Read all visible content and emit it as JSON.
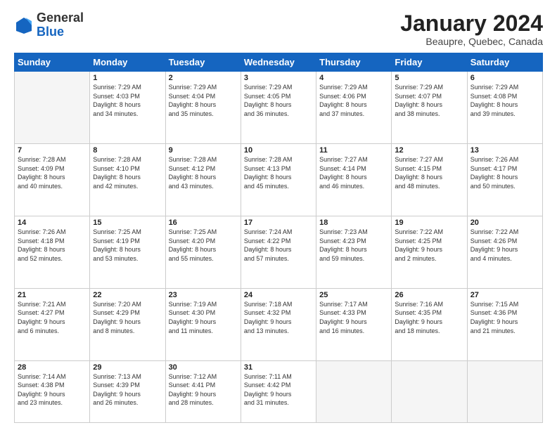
{
  "header": {
    "logo_line1": "General",
    "logo_line2": "Blue",
    "month_title": "January 2024",
    "subtitle": "Beaupre, Quebec, Canada"
  },
  "days_of_week": [
    "Sunday",
    "Monday",
    "Tuesday",
    "Wednesday",
    "Thursday",
    "Friday",
    "Saturday"
  ],
  "weeks": [
    [
      {
        "day": "",
        "info": ""
      },
      {
        "day": "1",
        "info": "Sunrise: 7:29 AM\nSunset: 4:03 PM\nDaylight: 8 hours\nand 34 minutes."
      },
      {
        "day": "2",
        "info": "Sunrise: 7:29 AM\nSunset: 4:04 PM\nDaylight: 8 hours\nand 35 minutes."
      },
      {
        "day": "3",
        "info": "Sunrise: 7:29 AM\nSunset: 4:05 PM\nDaylight: 8 hours\nand 36 minutes."
      },
      {
        "day": "4",
        "info": "Sunrise: 7:29 AM\nSunset: 4:06 PM\nDaylight: 8 hours\nand 37 minutes."
      },
      {
        "day": "5",
        "info": "Sunrise: 7:29 AM\nSunset: 4:07 PM\nDaylight: 8 hours\nand 38 minutes."
      },
      {
        "day": "6",
        "info": "Sunrise: 7:29 AM\nSunset: 4:08 PM\nDaylight: 8 hours\nand 39 minutes."
      }
    ],
    [
      {
        "day": "7",
        "info": "Sunrise: 7:28 AM\nSunset: 4:09 PM\nDaylight: 8 hours\nand 40 minutes."
      },
      {
        "day": "8",
        "info": "Sunrise: 7:28 AM\nSunset: 4:10 PM\nDaylight: 8 hours\nand 42 minutes."
      },
      {
        "day": "9",
        "info": "Sunrise: 7:28 AM\nSunset: 4:12 PM\nDaylight: 8 hours\nand 43 minutes."
      },
      {
        "day": "10",
        "info": "Sunrise: 7:28 AM\nSunset: 4:13 PM\nDaylight: 8 hours\nand 45 minutes."
      },
      {
        "day": "11",
        "info": "Sunrise: 7:27 AM\nSunset: 4:14 PM\nDaylight: 8 hours\nand 46 minutes."
      },
      {
        "day": "12",
        "info": "Sunrise: 7:27 AM\nSunset: 4:15 PM\nDaylight: 8 hours\nand 48 minutes."
      },
      {
        "day": "13",
        "info": "Sunrise: 7:26 AM\nSunset: 4:17 PM\nDaylight: 8 hours\nand 50 minutes."
      }
    ],
    [
      {
        "day": "14",
        "info": "Sunrise: 7:26 AM\nSunset: 4:18 PM\nDaylight: 8 hours\nand 52 minutes."
      },
      {
        "day": "15",
        "info": "Sunrise: 7:25 AM\nSunset: 4:19 PM\nDaylight: 8 hours\nand 53 minutes."
      },
      {
        "day": "16",
        "info": "Sunrise: 7:25 AM\nSunset: 4:20 PM\nDaylight: 8 hours\nand 55 minutes."
      },
      {
        "day": "17",
        "info": "Sunrise: 7:24 AM\nSunset: 4:22 PM\nDaylight: 8 hours\nand 57 minutes."
      },
      {
        "day": "18",
        "info": "Sunrise: 7:23 AM\nSunset: 4:23 PM\nDaylight: 8 hours\nand 59 minutes."
      },
      {
        "day": "19",
        "info": "Sunrise: 7:22 AM\nSunset: 4:25 PM\nDaylight: 9 hours\nand 2 minutes."
      },
      {
        "day": "20",
        "info": "Sunrise: 7:22 AM\nSunset: 4:26 PM\nDaylight: 9 hours\nand 4 minutes."
      }
    ],
    [
      {
        "day": "21",
        "info": "Sunrise: 7:21 AM\nSunset: 4:27 PM\nDaylight: 9 hours\nand 6 minutes."
      },
      {
        "day": "22",
        "info": "Sunrise: 7:20 AM\nSunset: 4:29 PM\nDaylight: 9 hours\nand 8 minutes."
      },
      {
        "day": "23",
        "info": "Sunrise: 7:19 AM\nSunset: 4:30 PM\nDaylight: 9 hours\nand 11 minutes."
      },
      {
        "day": "24",
        "info": "Sunrise: 7:18 AM\nSunset: 4:32 PM\nDaylight: 9 hours\nand 13 minutes."
      },
      {
        "day": "25",
        "info": "Sunrise: 7:17 AM\nSunset: 4:33 PM\nDaylight: 9 hours\nand 16 minutes."
      },
      {
        "day": "26",
        "info": "Sunrise: 7:16 AM\nSunset: 4:35 PM\nDaylight: 9 hours\nand 18 minutes."
      },
      {
        "day": "27",
        "info": "Sunrise: 7:15 AM\nSunset: 4:36 PM\nDaylight: 9 hours\nand 21 minutes."
      }
    ],
    [
      {
        "day": "28",
        "info": "Sunrise: 7:14 AM\nSunset: 4:38 PM\nDaylight: 9 hours\nand 23 minutes."
      },
      {
        "day": "29",
        "info": "Sunrise: 7:13 AM\nSunset: 4:39 PM\nDaylight: 9 hours\nand 26 minutes."
      },
      {
        "day": "30",
        "info": "Sunrise: 7:12 AM\nSunset: 4:41 PM\nDaylight: 9 hours\nand 28 minutes."
      },
      {
        "day": "31",
        "info": "Sunrise: 7:11 AM\nSunset: 4:42 PM\nDaylight: 9 hours\nand 31 minutes."
      },
      {
        "day": "",
        "info": ""
      },
      {
        "day": "",
        "info": ""
      },
      {
        "day": "",
        "info": ""
      }
    ]
  ]
}
